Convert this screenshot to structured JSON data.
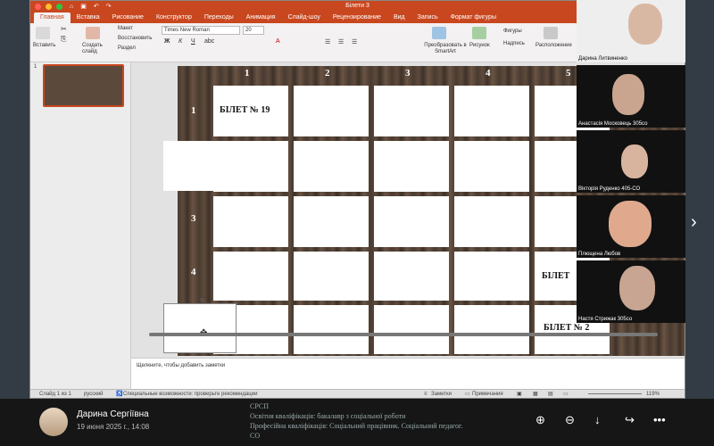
{
  "window": {
    "title": "Білети 3"
  },
  "tabs": [
    "Главная",
    "Вставка",
    "Рисование",
    "Конструктор",
    "Переходы",
    "Анимация",
    "Слайд-шоу",
    "Рецензирование",
    "Вид",
    "Запись",
    "Формат фигуры"
  ],
  "ribbon": {
    "paste": "Вставить",
    "new_slide": "Создать слайд",
    "layout": "Макет",
    "reset": "Восстановить",
    "section": "Раздел",
    "font_name": "Times New Roman",
    "font_size": "20",
    "smartart": "Преобразовать в SmartArt",
    "picture": "Рисунок",
    "shapes": "Фигуры",
    "textbox": "Надпись",
    "arrange": "Расположение"
  },
  "slide_pane": {
    "slide_number": "1"
  },
  "slide": {
    "col_headers": [
      "1",
      "2",
      "3",
      "4",
      "5"
    ],
    "row_headers": [
      "1",
      "3",
      "4"
    ],
    "cell_texts": [
      "БІЛЕТ № 19",
      "БІЛЕТ",
      "БІЛЕТ № 2"
    ]
  },
  "notes": {
    "placeholder": "Щелкните, чтобы добавить заметки"
  },
  "status": {
    "slide": "Слайд 1 из 1",
    "language": "русский",
    "accessibility": "Специальные возможности: проверьте рекомендации",
    "notes": "Заметки",
    "comments": "Примечания",
    "zoom": "119%"
  },
  "participants": [
    {
      "name": "Дарина Литвиненко"
    },
    {
      "name": "Анастасія Московець 305со"
    },
    {
      "name": "Вікторія Руденко 405-СО"
    },
    {
      "name": "Плющена Любов"
    },
    {
      "name": "Настя Стрижак 305со"
    }
  ],
  "footer": {
    "user": "Дарина Сергіївна",
    "date": "19 июня 2025 г., 14:08",
    "doc_lines": [
      "СРСП",
      "Освітня кваліфікація: бакалавр з соціальної роботи",
      "Професійна кваліфікація: Соціальний працівник. Соціальний педагог.",
      "СО"
    ]
  },
  "colors": {
    "accent": "#c9471f"
  }
}
